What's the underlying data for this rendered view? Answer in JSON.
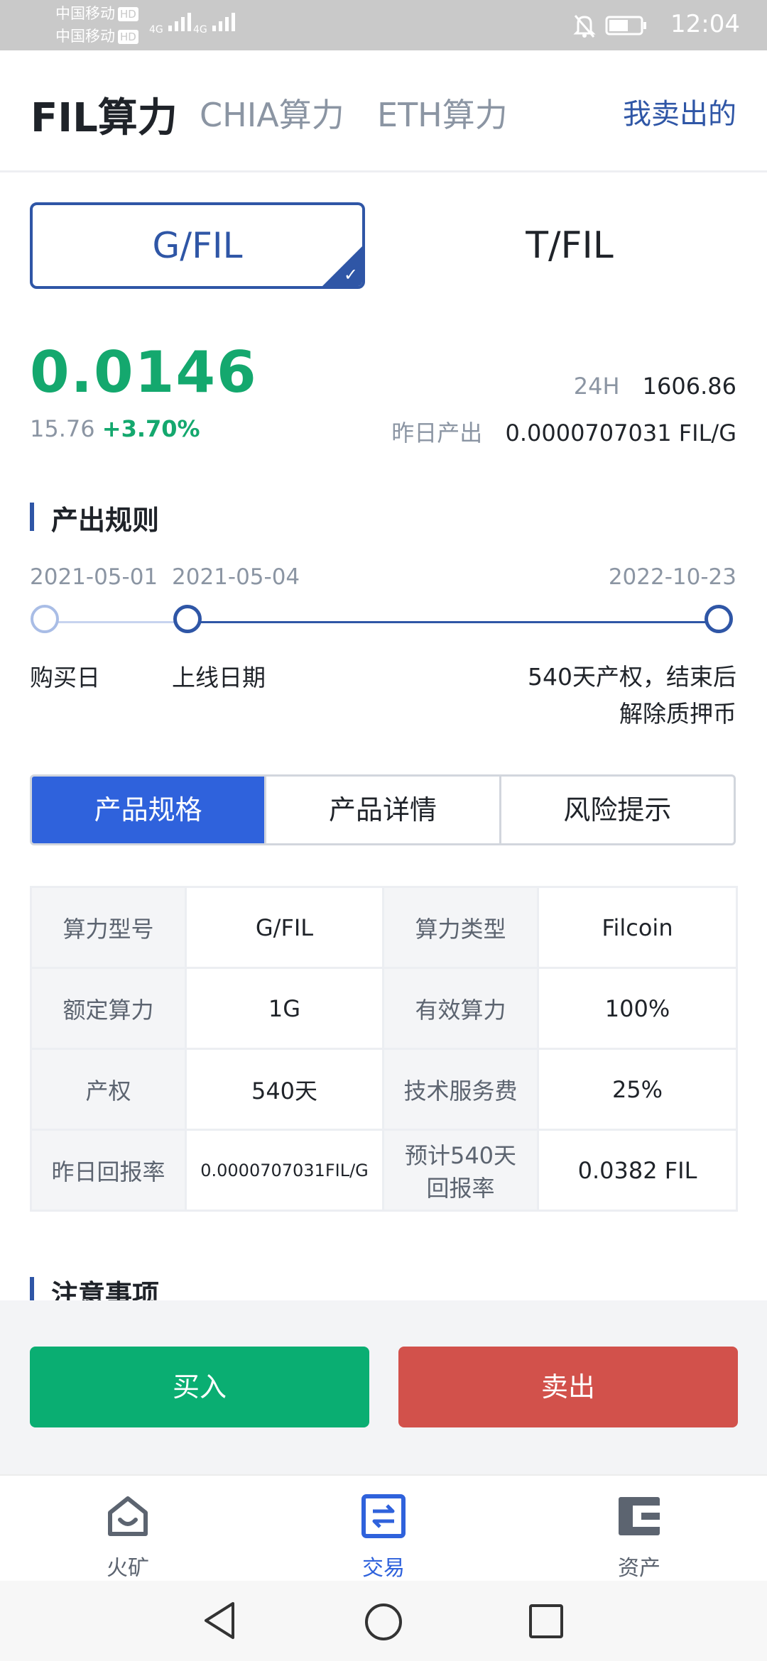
{
  "status_bar": {
    "carrier1": "中国移动",
    "carrier2": "中国移动",
    "hd": "HD",
    "network": "4G",
    "time": "12:04"
  },
  "header": {
    "tabs": [
      {
        "label": "FIL算力",
        "active": true
      },
      {
        "label": "CHIA算力",
        "active": false
      },
      {
        "label": "ETH算力",
        "active": false
      }
    ],
    "my_sold": "我卖出的"
  },
  "unit_selector": {
    "options": [
      {
        "label": "G/FIL",
        "selected": true
      },
      {
        "label": "T/FIL",
        "selected": false
      }
    ]
  },
  "price": {
    "value": "0.0146",
    "sub_value": "15.76",
    "change": "+3.70%",
    "volume_label": "24H",
    "volume_value": "1606.86",
    "yield_label": "昨日产出",
    "yield_value": "0.0000707031 FIL/G"
  },
  "rules": {
    "title": "产出规则",
    "dates": [
      "2021-05-01",
      "2021-05-04",
      "2022-10-23"
    ],
    "labels": [
      "购买日",
      "上线日期"
    ],
    "end_label_line1": "540天产权，结束后",
    "end_label_line2": "解除质押币"
  },
  "segment_tabs": [
    {
      "label": "产品规格",
      "active": true
    },
    {
      "label": "产品详情",
      "active": false
    },
    {
      "label": "风险提示",
      "active": false
    }
  ],
  "spec": {
    "rows": [
      {
        "k1": "算力型号",
        "v1": "G/FIL",
        "k2": "算力类型",
        "v2": "Filcoin"
      },
      {
        "k1": "额定算力",
        "v1": "1G",
        "k2": "有效算力",
        "v2": "100%"
      },
      {
        "k1": "产权",
        "v1": "540天",
        "k2": "技术服务费",
        "v2": "25%"
      },
      {
        "k1": "昨日回报率",
        "v1": "0.0000707031FIL/G",
        "k2a": "预计540天",
        "k2b": "回报率",
        "v2": "0.0382 FIL"
      }
    ]
  },
  "notes_title": "注意事项",
  "actions": {
    "buy": "买入",
    "sell": "卖出"
  },
  "bottom_nav": [
    {
      "label": "火矿",
      "icon": "home-icon",
      "active": false
    },
    {
      "label": "交易",
      "icon": "exchange-icon",
      "active": true
    },
    {
      "label": "资产",
      "icon": "wallet-icon",
      "active": false
    }
  ],
  "colors": {
    "accent": "#2f56a6",
    "primary_button": "#2f62dc",
    "up_green": "#14a86e",
    "buy": "#0aae72",
    "sell": "#d2514b"
  }
}
